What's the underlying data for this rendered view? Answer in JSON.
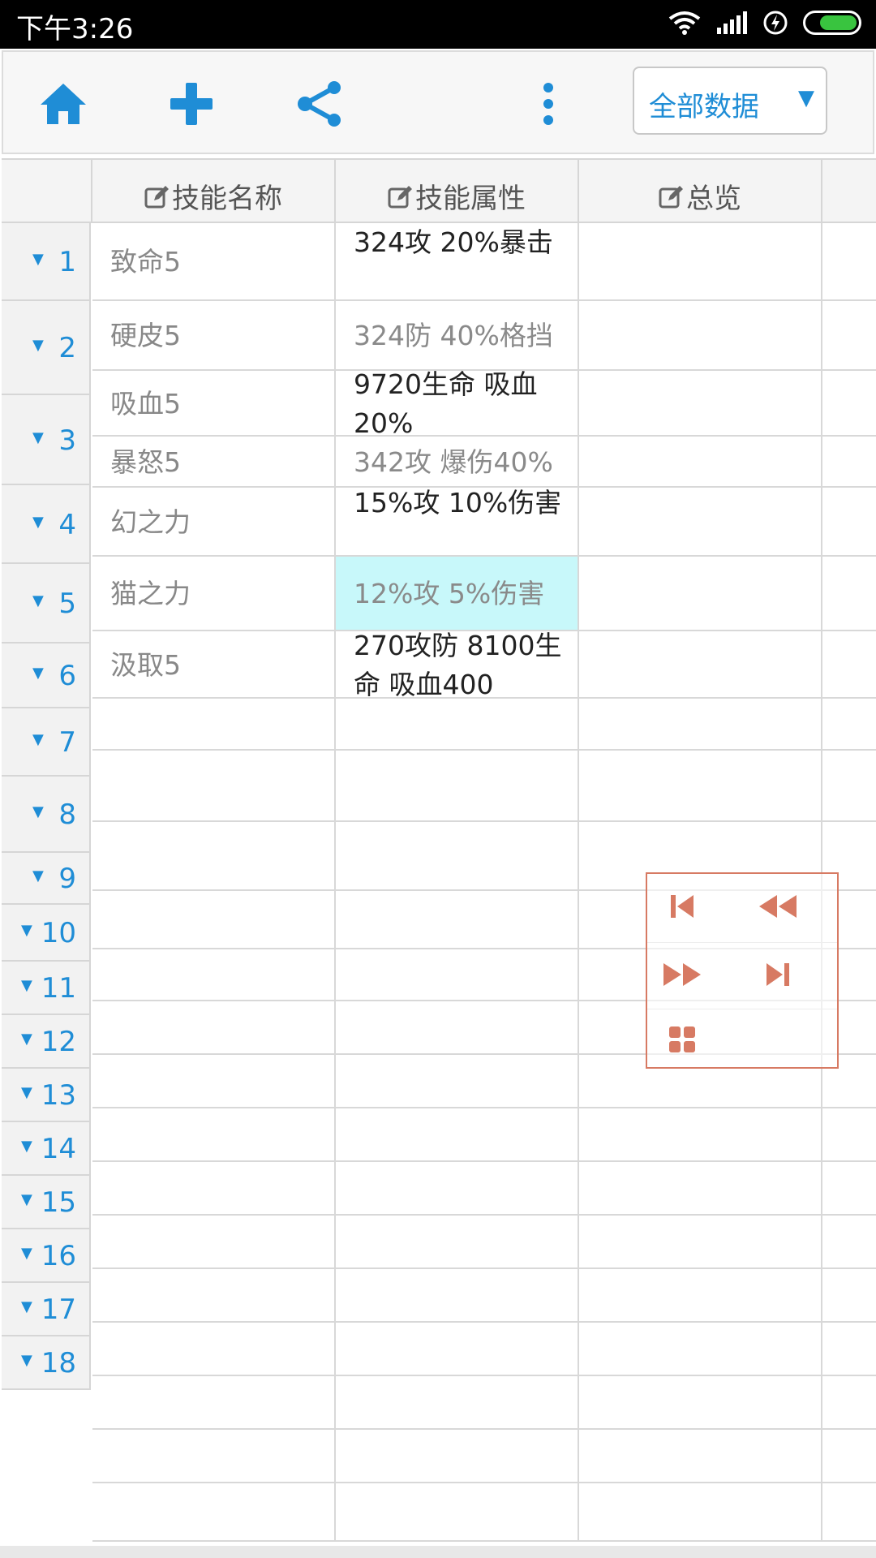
{
  "status": {
    "time": "下午3:26",
    "battery_level": 0.75
  },
  "toolbar": {
    "icons": [
      "home-icon",
      "plus-icon",
      "share-icon",
      "more-icon"
    ],
    "filter_label": "全部数据",
    "filter_caret": "▼"
  },
  "headers": [
    "技能名称",
    "技能属性",
    "总览"
  ],
  "rows": [
    {
      "num": "1",
      "name": "致命5",
      "attr": "324攻 20%暴击"
    },
    {
      "num": "2",
      "name": "硬皮5",
      "attr": "324防 40%格挡"
    },
    {
      "num": "3",
      "name": "吸血5",
      "attr": "9720生命 吸血20%"
    },
    {
      "num": "4",
      "name": "暴怒5",
      "attr": "342攻 爆伤40%"
    },
    {
      "num": "5",
      "name": "幻之力",
      "attr": "15%攻 10%伤害"
    },
    {
      "num": "6",
      "name": "猫之力",
      "attr": "12%攻 5%伤害"
    },
    {
      "num": "7",
      "name": "汲取5",
      "attr": "270攻防 8100生命 吸血400"
    }
  ],
  "row_numbers": [
    "1",
    "2",
    "3",
    "4",
    "5",
    "6",
    "7",
    "8",
    "9",
    "10",
    "11",
    "12",
    "13",
    "14",
    "15",
    "16",
    "17",
    "18"
  ],
  "row_marker": "▼",
  "colors": {
    "accent": "#1f8dd6",
    "nav": "#d77a63",
    "selected": "#c8f8fa"
  }
}
